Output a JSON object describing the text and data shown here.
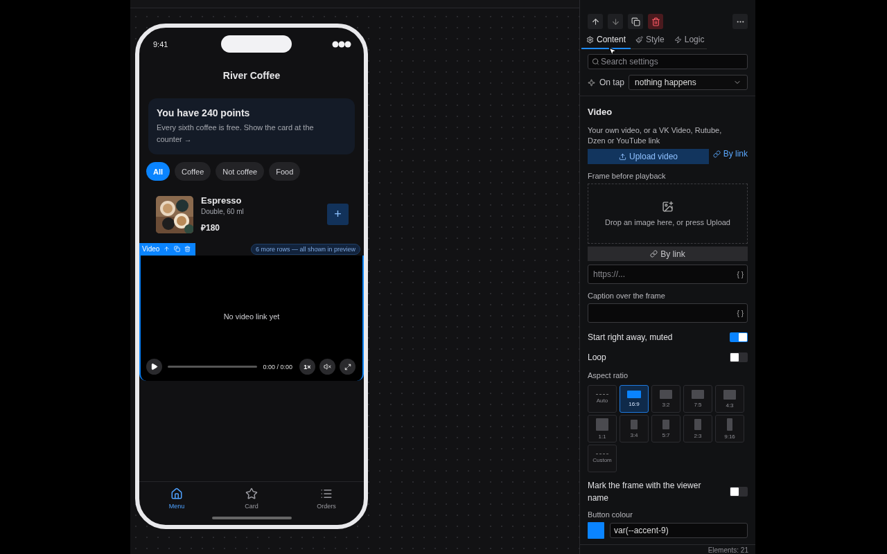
{
  "phone": {
    "time": "9:41",
    "title": "River Coffee",
    "points_card": {
      "title": "You have 240 points",
      "text": "Every sixth coffee is free. Show the card at the counter →"
    },
    "chips": [
      {
        "label": "All",
        "selected": true
      },
      {
        "label": "Coffee",
        "selected": false
      },
      {
        "label": "Not coffee",
        "selected": false
      },
      {
        "label": "Food",
        "selected": false
      }
    ],
    "product": {
      "name": "Espresso",
      "detail": "Double, 60 ml",
      "price": "₽180",
      "add": "+"
    },
    "selection_label": "Video",
    "rows_note": "6 more rows — all shown in preview",
    "video": {
      "message": "No video link yet",
      "time": "0:00 / 0:00",
      "speed": "1×"
    },
    "tabbar": [
      {
        "label": "Menu",
        "selected": true
      },
      {
        "label": "Card",
        "selected": false
      },
      {
        "label": "Orders",
        "selected": false
      }
    ]
  },
  "panel": {
    "tabs": [
      {
        "label": "Content",
        "selected": true
      },
      {
        "label": "Style",
        "selected": false
      },
      {
        "label": "Logic",
        "selected": false
      }
    ],
    "search": {
      "placeholder": "Search settings"
    },
    "on_tap": {
      "label": "On tap",
      "value": "nothing happens"
    },
    "section_title": "Video",
    "description": "Your own video, or a VK Video, Rutube, Dzen or YouTube link",
    "upload_button": "Upload video",
    "by_link": "By link",
    "frame_label": "Frame before playback",
    "drop_text": "Drop an image here, or press Upload",
    "frame_by_link": "By link",
    "url_field": {
      "placeholder": "https://...",
      "braces": "{ }"
    },
    "caption_label": "Caption over the frame",
    "caption_field": {
      "braces": "{ }"
    },
    "toggles": [
      {
        "label": "Start right away, muted",
        "on": true
      },
      {
        "label": "Loop",
        "on": false
      }
    ],
    "aspect_label": "Aspect ratio",
    "ratios": [
      {
        "label": "Auto",
        "kind": "free",
        "selected": false
      },
      {
        "label": "16:9",
        "kind": "shape",
        "selected": true
      },
      {
        "label": "3:2",
        "kind": "shape",
        "selected": false
      },
      {
        "label": "7:5",
        "kind": "shape",
        "selected": false
      },
      {
        "label": "4:3",
        "kind": "shape",
        "selected": false
      },
      {
        "label": "1:1",
        "kind": "shape",
        "selected": false
      },
      {
        "label": "3:4",
        "kind": "shape",
        "selected": false
      },
      {
        "label": "5:7",
        "kind": "shape",
        "selected": false
      },
      {
        "label": "2:3",
        "kind": "shape",
        "selected": false
      },
      {
        "label": "9:16",
        "kind": "shape",
        "selected": false
      },
      {
        "label": "Custom",
        "kind": "free",
        "selected": false
      }
    ],
    "mark_toggle": {
      "label": "Mark the frame with the viewer name",
      "on": false
    },
    "button_colour": {
      "label": "Button colour",
      "color": "#0a84ff",
      "value": "var(--accent-9)"
    }
  },
  "status_bar": "Elements: 21"
}
